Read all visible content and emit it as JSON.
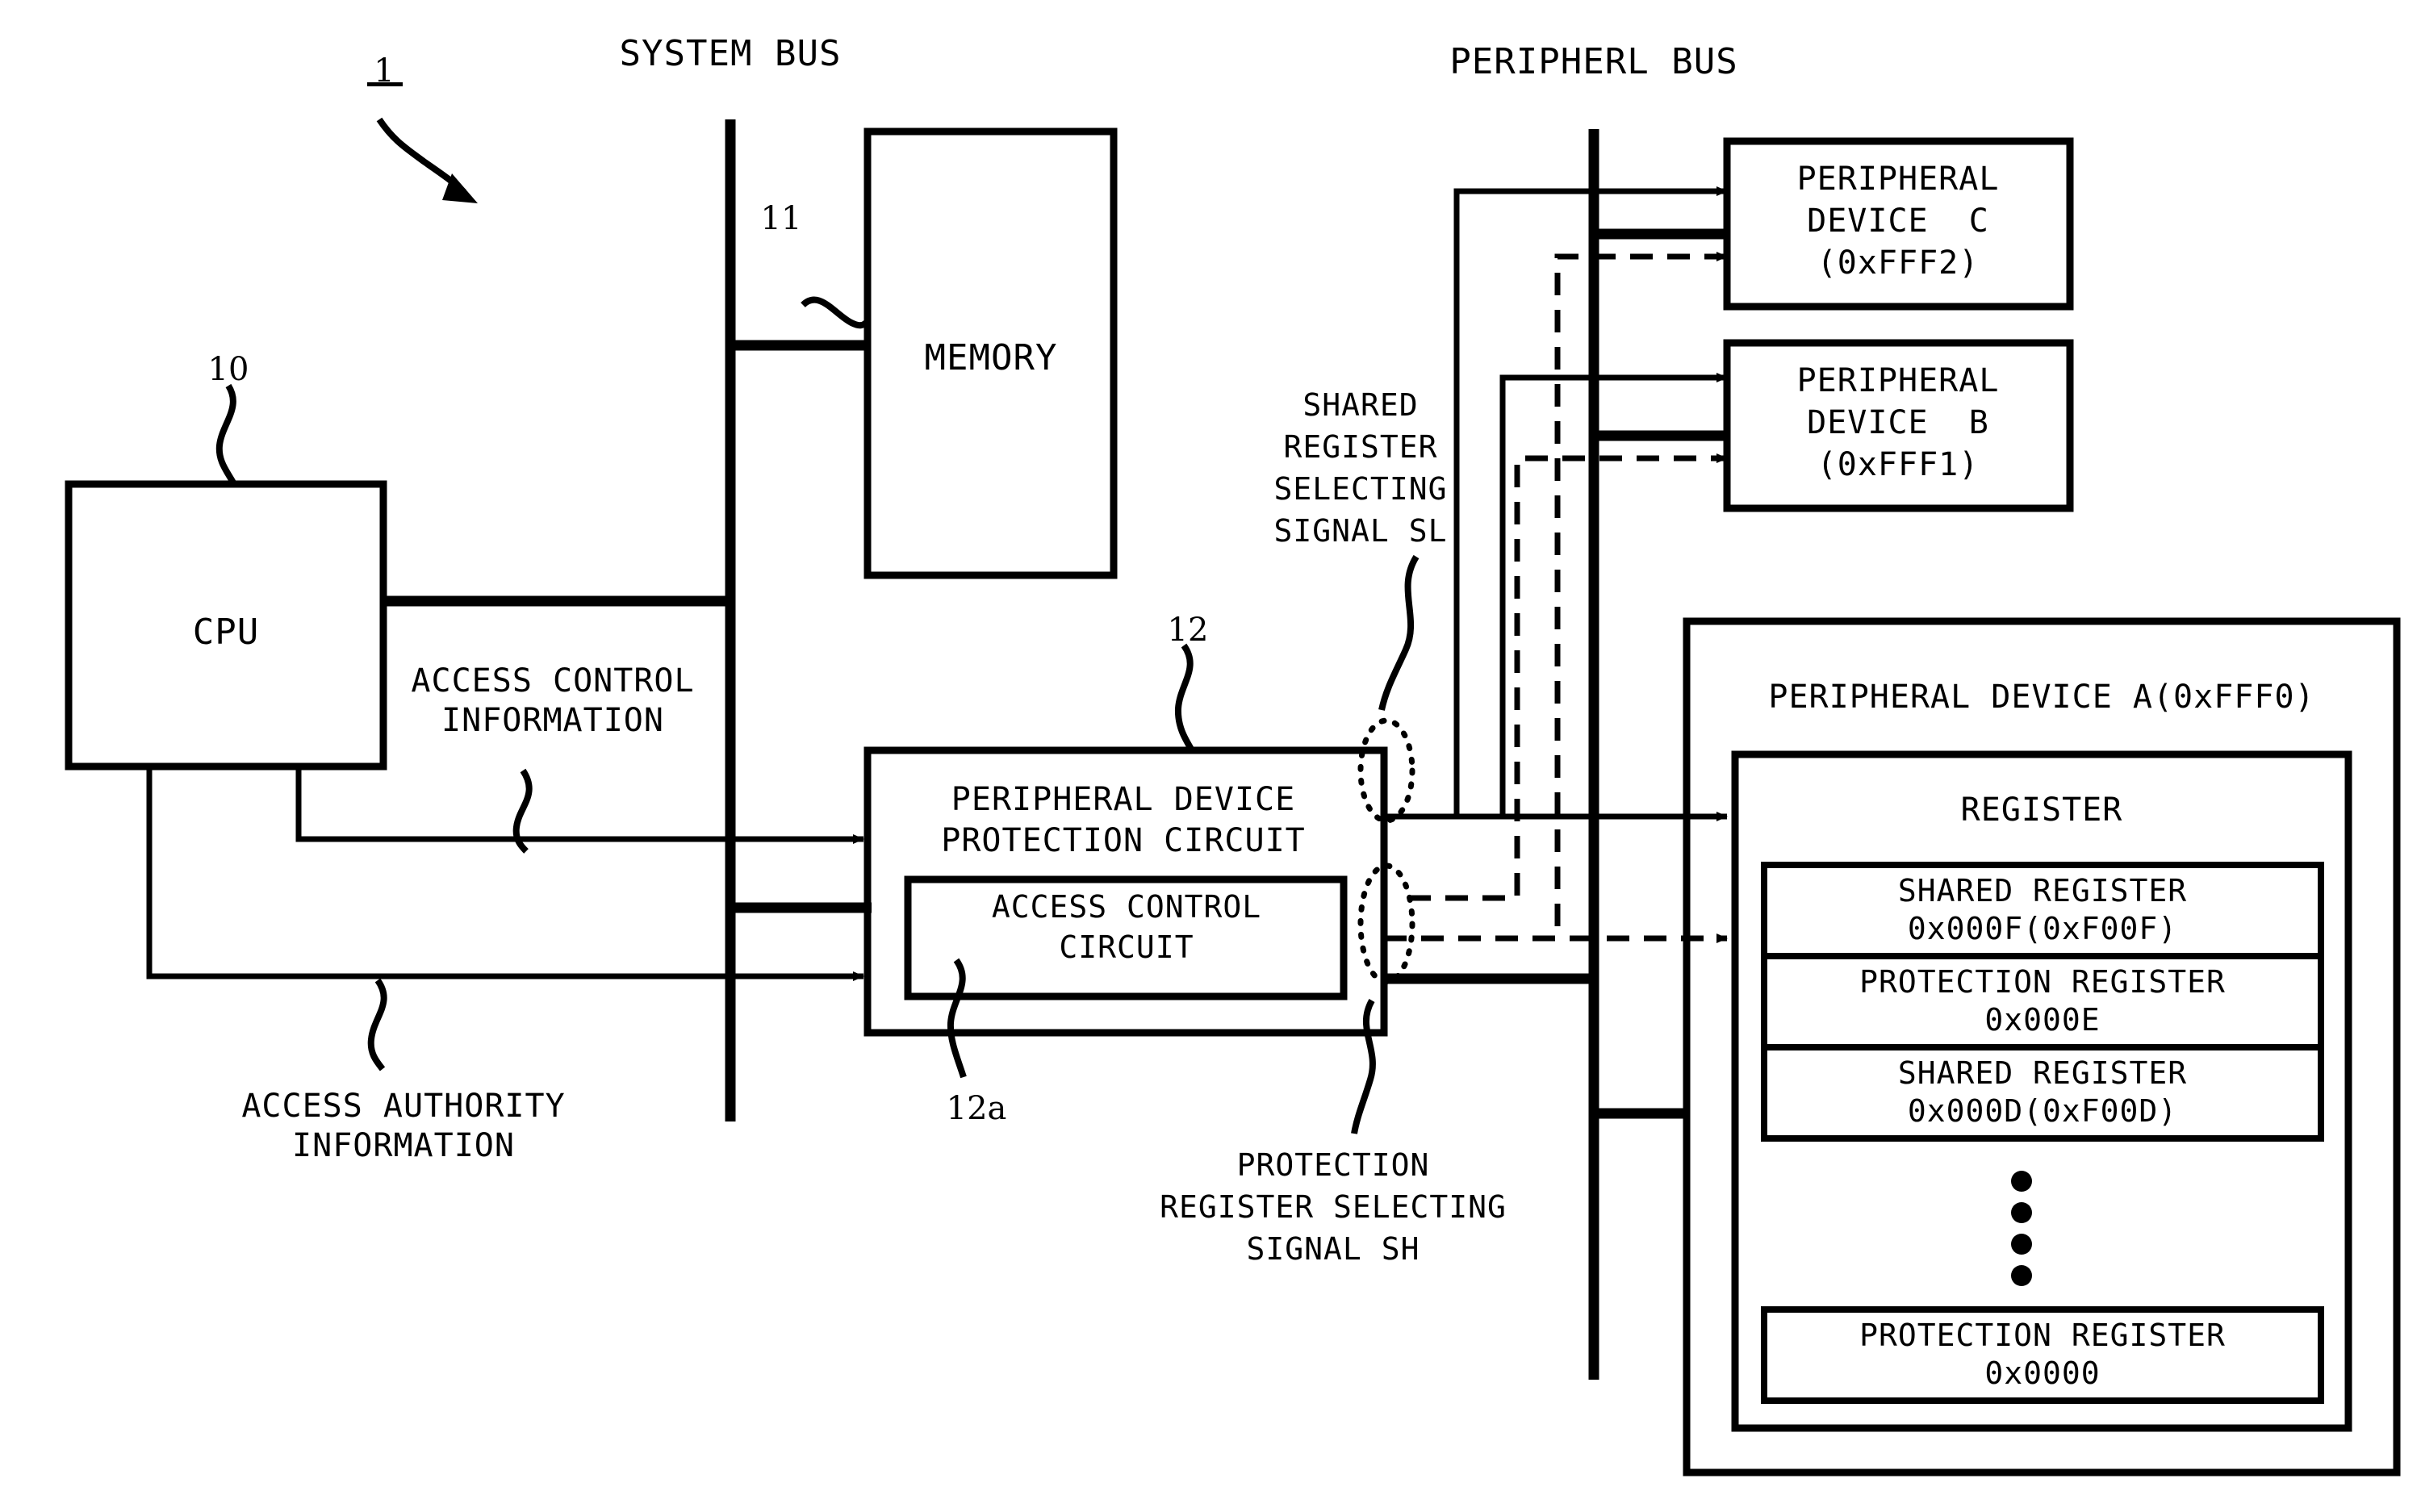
{
  "figure": {
    "reference_numeral_system": "1",
    "bus_labels": {
      "system_bus": "SYSTEM BUS",
      "peripheral_bus": "PERIPHERL BUS"
    },
    "blocks": {
      "cpu": {
        "label": "CPU",
        "ref": "10"
      },
      "memory": {
        "label": "MEMORY",
        "ref": "11"
      },
      "protection_circuit": {
        "line1": "PERIPHERAL DEVICE",
        "line2": "PROTECTION CIRCUIT",
        "ref": "12"
      },
      "access_control_circuit": {
        "line1": "ACCESS CONTROL",
        "line2": "CIRCUIT",
        "ref": "12a"
      },
      "peripheral_device_c": {
        "line1": "PERIPHERAL",
        "line2": "DEVICE  C",
        "line3": "(0xFFF2)"
      },
      "peripheral_device_b": {
        "line1": "PERIPHERAL",
        "line2": "DEVICE  B",
        "line3": "(0xFFF1)"
      },
      "peripheral_device_a": {
        "title": "PERIPHERAL DEVICE A(0xFFF0)",
        "register_title": "REGISTER",
        "rows": [
          {
            "line1": "SHARED REGISTER",
            "line2": "0x000F(0xF00F)"
          },
          {
            "line1": "PROTECTION REGISTER",
            "line2": "0x000E"
          },
          {
            "line1": "SHARED REGISTER",
            "line2": "0x000D(0xF00D)"
          },
          {
            "line1": "PROTECTION REGISTER",
            "line2": "0x0000"
          }
        ],
        "ellipsis_dots": 4
      }
    },
    "signal_labels": {
      "access_control_information": {
        "line1": "ACCESS CONTROL",
        "line2": "INFORMATION"
      },
      "access_authority_information": {
        "line1": "ACCESS AUTHORITY",
        "line2": "INFORMATION"
      },
      "shared_register_selecting_signal": {
        "line1": "SHARED",
        "line2": "REGISTER",
        "line3": "SELECTING",
        "line4": "SIGNAL SL"
      },
      "protection_register_selecting_signal": {
        "line1": "PROTECTION",
        "line2": "REGISTER SELECTING",
        "line3": "SIGNAL SH"
      }
    },
    "colors": {
      "ink": "#000000",
      "paper": "#ffffff"
    }
  }
}
